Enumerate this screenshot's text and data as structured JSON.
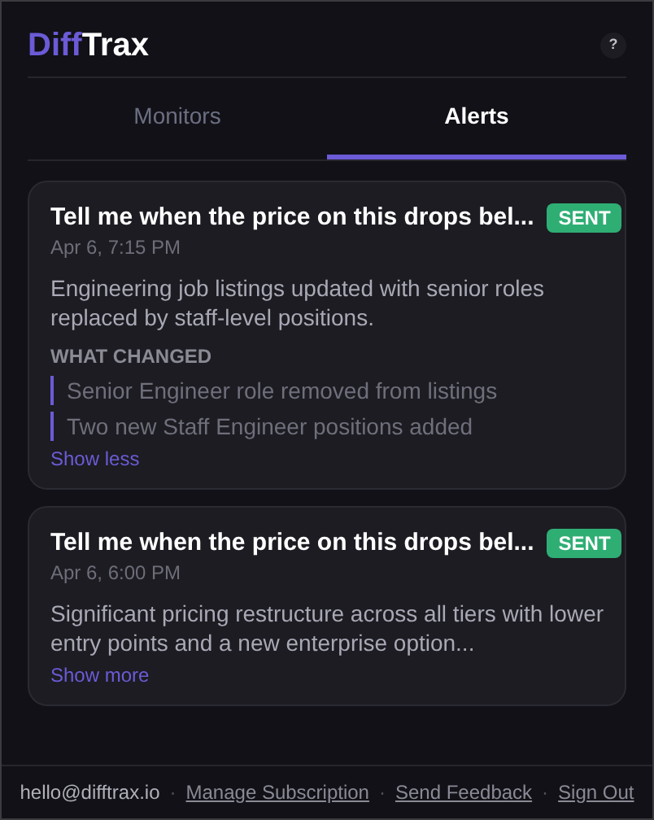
{
  "logo": {
    "accent": "Diff",
    "rest": "Trax"
  },
  "help_button": {
    "label": "?"
  },
  "tabs": [
    {
      "label": "Monitors",
      "selected": false
    },
    {
      "label": "Alerts",
      "selected": true
    }
  ],
  "alerts": [
    {
      "title": "Tell me when the price on this drops bel...",
      "status": {
        "kind": "sent",
        "label": "SENT"
      },
      "date": "Apr 6, 7:15 PM",
      "summary": "Engineering job listings updated with senior roles replaced by staff-level positions.",
      "expanded": true,
      "changes_heading": "WHAT CHANGED",
      "changes": [
        "Senior Engineer role removed from listings",
        "Two new Staff Engineer positions added"
      ],
      "toggle": "Show less"
    },
    {
      "title": "Tell me when the price on this drops bel...",
      "status": {
        "kind": "sent",
        "label": "SENT"
      },
      "date": "Apr 6, 6:00 PM",
      "summary": "Significant pricing restructure across all tiers with lower entry points and a new enterprise option...",
      "expanded": false,
      "toggle": "Show more"
    }
  ],
  "footer": [
    {
      "kind": "text",
      "text": "hello@difftrax.io"
    },
    {
      "kind": "separator",
      "text": "·"
    },
    {
      "kind": "link",
      "text": "Manage Subscription"
    },
    {
      "kind": "separator",
      "text": "·"
    },
    {
      "kind": "link",
      "text": "Send Feedback"
    },
    {
      "kind": "separator",
      "text": "·"
    },
    {
      "kind": "link",
      "text": "Sign Out"
    }
  ]
}
